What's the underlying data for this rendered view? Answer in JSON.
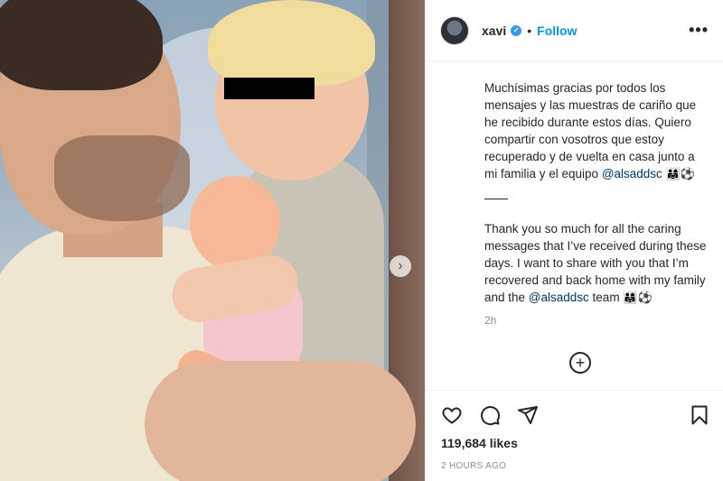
{
  "post": {
    "image_alt": "Photo of a man holding a child with a doll",
    "carousel_next_glyph": "›"
  },
  "header": {
    "username": "xavi",
    "verified_glyph": "✓",
    "separator": "•",
    "follow_label": "Follow",
    "more_glyph": "•••"
  },
  "caption": {
    "paragraph1_text": "Muchísimas gracias por todos los mensajes y las muestras de cariño que he recibido durante estos días. Quiero compartir con vosotros que estoy recuperado y de vuelta en casa junto a mi familia y el equipo ",
    "paragraph1_mention": "@alsaddsc",
    "paragraph1_emoji": "👨‍👩‍👧⚽",
    "paragraph2_text": "Thank you so much for all the caring messages that I’ve received during these days. I want to share with you that I’m recovered and back home with my family and the ",
    "paragraph2_mention": "@alsaddsc",
    "paragraph2_after": " team ",
    "paragraph2_emoji": "👨‍👩‍👧⚽"
  },
  "comment_time": "2h",
  "add_comment_glyph": "+",
  "actions": {
    "icons": [
      "heart-icon",
      "comment-icon",
      "share-icon",
      "bookmark-icon"
    ]
  },
  "likes_text": "119,684 likes",
  "posted_time": "2 HOURS AGO",
  "colors": {
    "accent": "#0095f6",
    "mention": "#00376b",
    "text": "#262626",
    "muted": "#8e8e8e"
  }
}
